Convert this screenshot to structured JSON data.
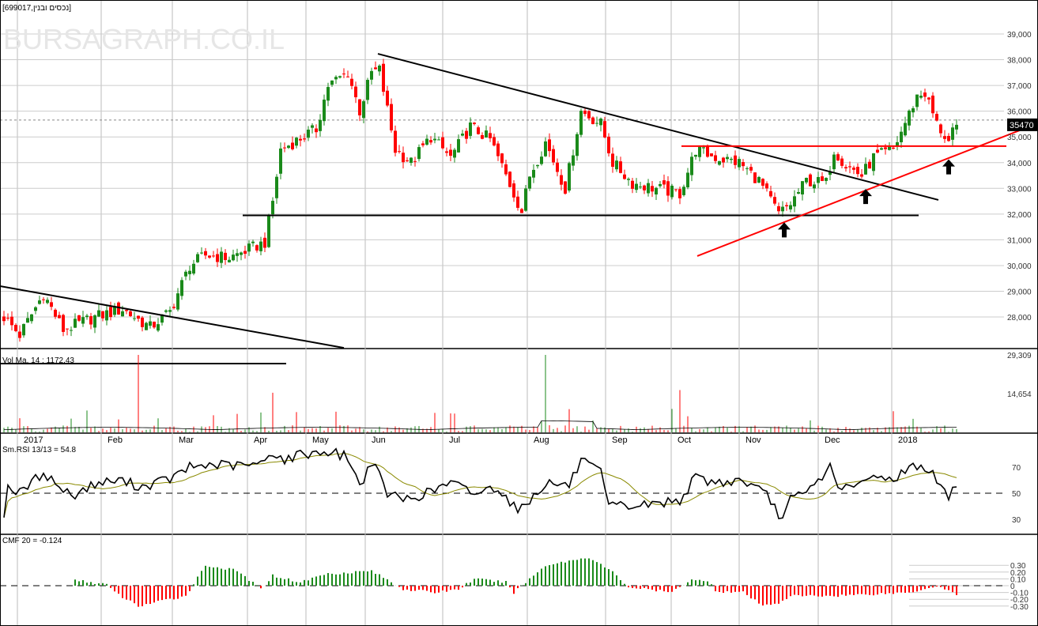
{
  "header": {
    "title": "[699017,נכסים ובנין]",
    "watermark": "BURSAGRAPH.CO.IL"
  },
  "colors": {
    "up": "#1a8a1a",
    "down": "#ff0000",
    "trend_red": "#ff0000",
    "trend_black": "#000000",
    "rsi_ma": "#8a8a00"
  },
  "chart_data": [
    {
      "type": "candlestick",
      "title": "699017 נכסים ובנין",
      "x_unit": "bar index",
      "ylim": [
        26700,
        39800
      ],
      "y_ticks": [
        "39,000",
        "38,000",
        "37,000",
        "36,000",
        "35,000",
        "34,000",
        "33,000",
        "32,000",
        "31,000",
        "30,000",
        "29,000",
        "28,000"
      ],
      "y_tick_values": [
        39000,
        38000,
        37000,
        36000,
        35000,
        34000,
        33000,
        32000,
        31000,
        30000,
        29000,
        28000
      ],
      "last_price": "35470",
      "last_price_value": 35470,
      "close_path": [
        [
          0,
          28000
        ],
        [
          4,
          27300
        ],
        [
          10,
          28900
        ],
        [
          15,
          27500
        ],
        [
          23,
          28000
        ],
        [
          30,
          28300
        ],
        [
          37,
          27600
        ],
        [
          42,
          28200
        ],
        [
          47,
          30000
        ],
        [
          51,
          30400
        ],
        [
          57,
          30300
        ],
        [
          66,
          30900
        ],
        [
          68,
          32500
        ],
        [
          70,
          34500
        ],
        [
          79,
          35300
        ],
        [
          82,
          37000
        ],
        [
          87,
          37500
        ],
        [
          90,
          36000
        ],
        [
          93,
          37500
        ],
        [
          95,
          37600
        ],
        [
          99,
          34500
        ],
        [
          103,
          34000
        ],
        [
          108,
          35000
        ],
        [
          113,
          34200
        ],
        [
          118,
          35400
        ],
        [
          123,
          34900
        ],
        [
          127,
          33500
        ],
        [
          131,
          32100
        ],
        [
          133,
          33500
        ],
        [
          137,
          34800
        ],
        [
          142,
          33000
        ],
        [
          146,
          36000
        ],
        [
          151,
          35500
        ],
        [
          154,
          34000
        ],
        [
          159,
          33200
        ],
        [
          165,
          33000
        ],
        [
          171,
          32800
        ],
        [
          175,
          34500
        ],
        [
          180,
          34200
        ],
        [
          186,
          34000
        ],
        [
          191,
          33300
        ],
        [
          196,
          32000
        ],
        [
          199,
          32400
        ],
        [
          203,
          33300
        ],
        [
          208,
          33200
        ],
        [
          210,
          34500
        ],
        [
          213,
          33900
        ],
        [
          217,
          33500
        ],
        [
          220,
          34200
        ],
        [
          225,
          34500
        ],
        [
          227,
          35200
        ],
        [
          231,
          36600
        ],
        [
          233,
          36700
        ],
        [
          236,
          35500
        ],
        [
          239,
          34800
        ],
        [
          241,
          35470
        ]
      ],
      "trendlines": [
        {
          "color": "black",
          "from": [
            -1,
            29200
          ],
          "to": [
            86,
            26800
          ]
        },
        {
          "color": "black",
          "from": [
            94.6,
            38230
          ],
          "to": [
            236.4,
            32550
          ]
        },
        {
          "color": "black",
          "from": [
            60.4,
            31950
          ],
          "to": [
            231.4,
            31950
          ]
        },
        {
          "color": "red",
          "from": [
            171.4,
            34640
          ],
          "to": [
            253.6,
            34640
          ]
        },
        {
          "color": "red",
          "from": [
            175.4,
            30370
          ],
          "to": [
            261.6,
            35530
          ]
        }
      ],
      "arrows": [
        [
          197.4,
          31400
        ],
        [
          218,
          32700
        ],
        [
          239,
          33850
        ]
      ],
      "months": [
        "2017",
        "Feb",
        "Mar",
        "Apr",
        "May",
        "Jun",
        "Jul",
        "Aug",
        "Sep",
        "Oct",
        "Nov",
        "Dec",
        "2018"
      ],
      "month_bar_index": [
        7,
        28.2,
        46.2,
        65.2,
        80,
        95,
        114.6,
        136,
        155.8,
        172.4,
        189.6,
        209.6,
        228.2
      ]
    },
    {
      "type": "bar",
      "title": "Vol Ma. 14 : 1172.43",
      "y_ticks": [
        "29,309",
        "14,654"
      ],
      "y_tick_values": [
        29309,
        14654
      ],
      "spikes": [
        [
          33.6,
          29309
        ],
        [
          137,
          29309
        ],
        [
          170.6,
          16000
        ],
        [
          67.8,
          15000
        ],
        [
          224.6,
          8000
        ]
      ]
    },
    {
      "type": "line",
      "title": "Sm.RSI 13/13 = 54.8",
      "y_ticks": [
        "70",
        "50",
        "30"
      ],
      "y_tick_values": [
        70,
        50,
        30
      ],
      "ylim": [
        22,
        93
      ],
      "rsi_path": [
        [
          0,
          35
        ],
        [
          1,
          55
        ],
        [
          4,
          50
        ],
        [
          10,
          66
        ],
        [
          14,
          55
        ],
        [
          17,
          48
        ],
        [
          23,
          57
        ],
        [
          29,
          60
        ],
        [
          35,
          55
        ],
        [
          43,
          62
        ],
        [
          47,
          70
        ],
        [
          53,
          72
        ],
        [
          59,
          71
        ],
        [
          65,
          72
        ],
        [
          68,
          82
        ],
        [
          71,
          75
        ],
        [
          75,
          80
        ],
        [
          82,
          82
        ],
        [
          87,
          78
        ],
        [
          90,
          55
        ],
        [
          93,
          75
        ],
        [
          97,
          50
        ],
        [
          101,
          45
        ],
        [
          107,
          50
        ],
        [
          113,
          58
        ],
        [
          119,
          50
        ],
        [
          125,
          55
        ],
        [
          129,
          40
        ],
        [
          131,
          38
        ],
        [
          137,
          58
        ],
        [
          143,
          56
        ],
        [
          146,
          75
        ],
        [
          151,
          65
        ],
        [
          153,
          40
        ],
        [
          159,
          40
        ],
        [
          165,
          42
        ],
        [
          171,
          45
        ],
        [
          175,
          62
        ],
        [
          180,
          58
        ],
        [
          187,
          60
        ],
        [
          193,
          48
        ],
        [
          197,
          30
        ],
        [
          199,
          45
        ],
        [
          203,
          50
        ],
        [
          209,
          70
        ],
        [
          212,
          52
        ],
        [
          217,
          57
        ],
        [
          221,
          65
        ],
        [
          224,
          60
        ],
        [
          227,
          65
        ],
        [
          231,
          72
        ],
        [
          234,
          68
        ],
        [
          237,
          55
        ],
        [
          239,
          47
        ],
        [
          241,
          54.8
        ]
      ]
    },
    {
      "type": "bar",
      "title": "CMF 20 = -0.124",
      "y_ticks": [
        "0.30",
        "0.20",
        "0.10",
        "0",
        "-0.10",
        "-0.20",
        "-0.30"
      ],
      "y_tick_values": [
        0.3,
        0.2,
        0.1,
        0,
        -0.1,
        -0.2,
        -0.3
      ],
      "cmf_path": [
        [
          18,
          0.08
        ],
        [
          26,
          0.02
        ],
        [
          28,
          -0.1
        ],
        [
          34,
          -0.3
        ],
        [
          46,
          -0.15
        ],
        [
          51,
          0.3
        ],
        [
          59,
          0.22
        ],
        [
          65,
          -0.05
        ],
        [
          68,
          0.15
        ],
        [
          75,
          0.05
        ],
        [
          81,
          0.17
        ],
        [
          93,
          0.22
        ],
        [
          101,
          -0.05
        ],
        [
          109,
          -0.1
        ],
        [
          115,
          -0.05
        ],
        [
          119,
          0.1
        ],
        [
          127,
          0.05
        ],
        [
          129,
          -0.1
        ],
        [
          137,
          0.3
        ],
        [
          148,
          0.42
        ],
        [
          154,
          0.2
        ],
        [
          158,
          -0.02
        ],
        [
          169,
          -0.1
        ],
        [
          174,
          0.1
        ],
        [
          179,
          0.04
        ],
        [
          180,
          -0.08
        ],
        [
          187,
          -0.1
        ],
        [
          192,
          -0.3
        ],
        [
          196,
          -0.25
        ],
        [
          199,
          -0.15
        ],
        [
          209,
          -0.15
        ],
        [
          229,
          -0.1
        ],
        [
          236,
          0.0
        ],
        [
          241,
          -0.12
        ]
      ]
    }
  ]
}
